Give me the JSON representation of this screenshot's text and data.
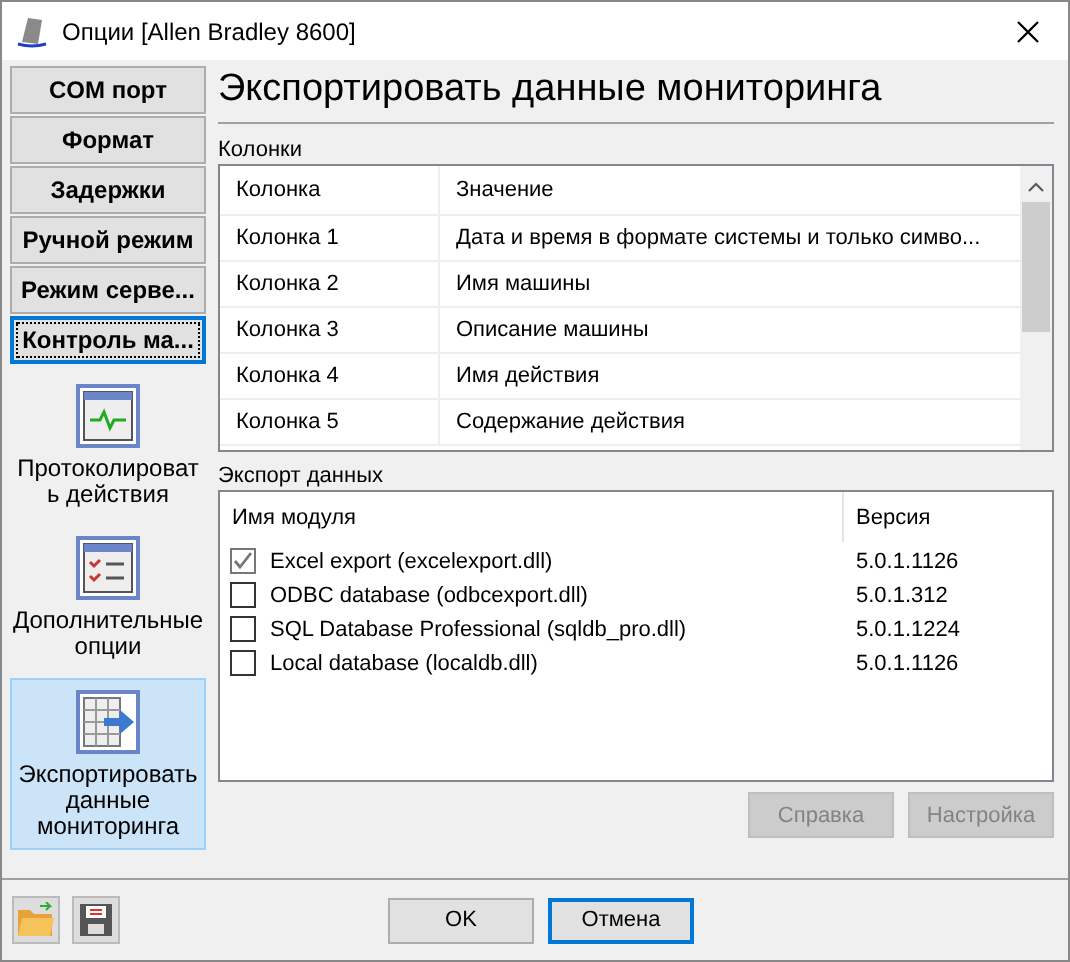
{
  "window": {
    "title": "Опции [Allen Bradley 8600]"
  },
  "sidebar": {
    "buttons": [
      {
        "label": "COM порт",
        "selected": false
      },
      {
        "label": "Формат",
        "selected": false
      },
      {
        "label": "Задержки",
        "selected": false
      },
      {
        "label": "Ручной режим",
        "selected": false
      },
      {
        "label": "Режим серве...",
        "selected": false
      },
      {
        "label": "Контроль ма...",
        "selected": true
      }
    ],
    "items": [
      {
        "label": "Протоколироват ь действия",
        "kind": "log",
        "selected": false
      },
      {
        "label": "Дополнительные опции",
        "kind": "options",
        "selected": false
      },
      {
        "label": "Экспортировать данные мониторинга",
        "kind": "export",
        "selected": true
      }
    ]
  },
  "page_title": "Экспортировать данные мониторинга",
  "columns_section": {
    "label": "Колонки",
    "headers": [
      "Колонка",
      "Значение"
    ],
    "rows": [
      [
        "Колонка 1",
        "Дата и время в формате системы и только симво..."
      ],
      [
        "Колонка 2",
        "Имя машины"
      ],
      [
        "Колонка 3",
        "Описание машины"
      ],
      [
        "Колонка 4",
        "Имя действия"
      ],
      [
        "Колонка 5",
        "Содержание действия"
      ]
    ]
  },
  "export_section": {
    "label": "Экспорт данных",
    "headers": [
      "Имя модуля",
      "Версия"
    ],
    "rows": [
      {
        "name": "Excel export (excelexport.dll)",
        "version": "5.0.1.1126",
        "checked": true
      },
      {
        "name": "ODBC database (odbcexport.dll)",
        "version": "5.0.1.312",
        "checked": false
      },
      {
        "name": "SQL Database Professional (sqldb_pro.dll)",
        "version": "5.0.1.1224",
        "checked": false
      },
      {
        "name": "Local database (localdb.dll)",
        "version": "5.0.1.1126",
        "checked": false
      }
    ],
    "buttons": [
      {
        "label": "Справка",
        "disabled": true
      },
      {
        "label": "Настройка",
        "disabled": true
      }
    ]
  },
  "footer_buttons": [
    {
      "label": "OK",
      "selected": false
    },
    {
      "label": "Отмена",
      "selected": true
    }
  ]
}
